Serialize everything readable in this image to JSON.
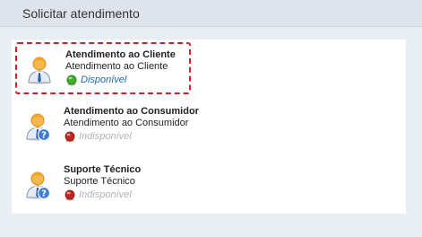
{
  "header": {
    "title": "Solicitar atendimento"
  },
  "items": [
    {
      "name": "Atendimento ao Cliente",
      "subtitle": "Atendimento ao Cliente",
      "status": "Disponível",
      "available": true,
      "selected": true,
      "icon": "user-icon"
    },
    {
      "name": "Atendimento ao Consumidor",
      "subtitle": "Atendimento ao Consumidor",
      "status": "Indisponível",
      "available": false,
      "selected": false,
      "icon": "user-help-icon"
    },
    {
      "name": "Suporte Técnico",
      "subtitle": "Suporte Técnico",
      "status": "Indisponível",
      "available": false,
      "selected": false,
      "icon": "user-help-icon"
    }
  ],
  "colors": {
    "available": "#3fae2a",
    "unavailable": "#c0271e",
    "selection_border": "#d0222a",
    "link_blue": "#1a6bb5"
  }
}
